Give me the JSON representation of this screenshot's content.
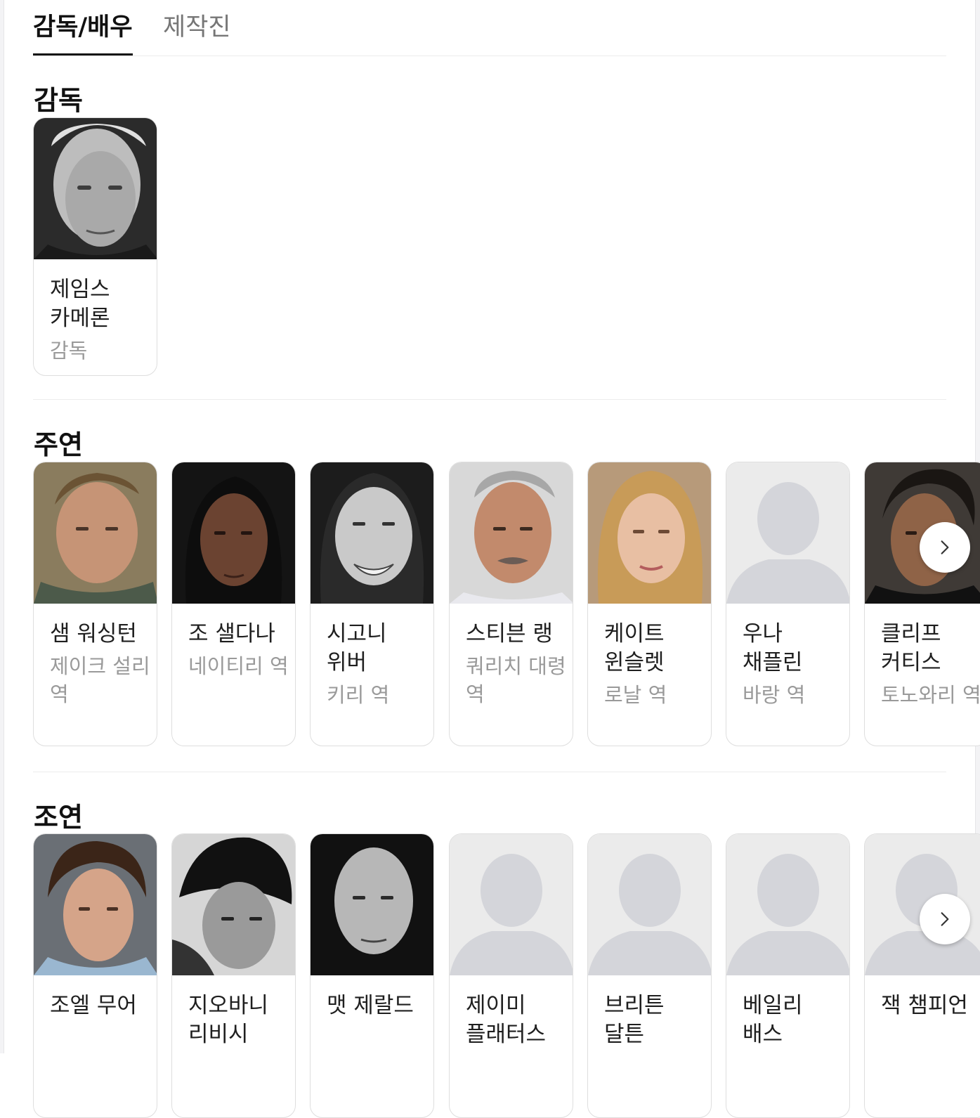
{
  "tabs": [
    {
      "label": "감독/배우",
      "active": true
    },
    {
      "label": "제작진",
      "active": false
    }
  ],
  "sections": {
    "director": {
      "title": "감독",
      "cards": [
        {
          "name": "제임스 카메론",
          "role": "감독",
          "photo": "bw-portrait"
        }
      ]
    },
    "lead": {
      "title": "주연",
      "cards": [
        {
          "name": "샘 워싱턴",
          "role": "제이크 설리 역",
          "photo": "color-portrait"
        },
        {
          "name": "조 샐다나",
          "role": "네이티리 역",
          "photo": "color-portrait"
        },
        {
          "name": "시고니 위버",
          "role": "키리 역",
          "photo": "bw-portrait"
        },
        {
          "name": "스티븐 랭",
          "role": "쿼리치 대령 역",
          "photo": "color-portrait"
        },
        {
          "name": "케이트 윈슬렛",
          "role": "로날 역",
          "photo": "color-portrait"
        },
        {
          "name": "우나 채플린",
          "role": "바랑 역",
          "photo": "placeholder-silhouette"
        },
        {
          "name": "클리프 커티스",
          "role": "토노와리 역",
          "photo": "color-portrait"
        }
      ]
    },
    "supporting": {
      "title": "조연",
      "cards": [
        {
          "name": "조엘 무어",
          "role": "",
          "photo": "color-portrait"
        },
        {
          "name": "지오바니 리비시",
          "role": "",
          "photo": "bw-portrait"
        },
        {
          "name": "맷 제랄드",
          "role": "",
          "photo": "bw-portrait"
        },
        {
          "name": "제이미 플래터스",
          "role": "",
          "photo": "placeholder-silhouette"
        },
        {
          "name": "브리튼 달튼",
          "role": "",
          "photo": "placeholder-silhouette"
        },
        {
          "name": "베일리 배스",
          "role": "",
          "photo": "placeholder-silhouette"
        },
        {
          "name": "잭 챔피언",
          "role": "",
          "photo": "placeholder-silhouette"
        }
      ]
    }
  },
  "icons": {
    "next": "chevron-right-icon",
    "placeholder": "person-silhouette-icon"
  },
  "colors": {
    "text": "#1f1f1f",
    "subtext": "#9a9a9a",
    "inactive_tab": "#767676",
    "placeholder_bg": "#ebebeb",
    "placeholder_figure": "#d4d5da"
  }
}
